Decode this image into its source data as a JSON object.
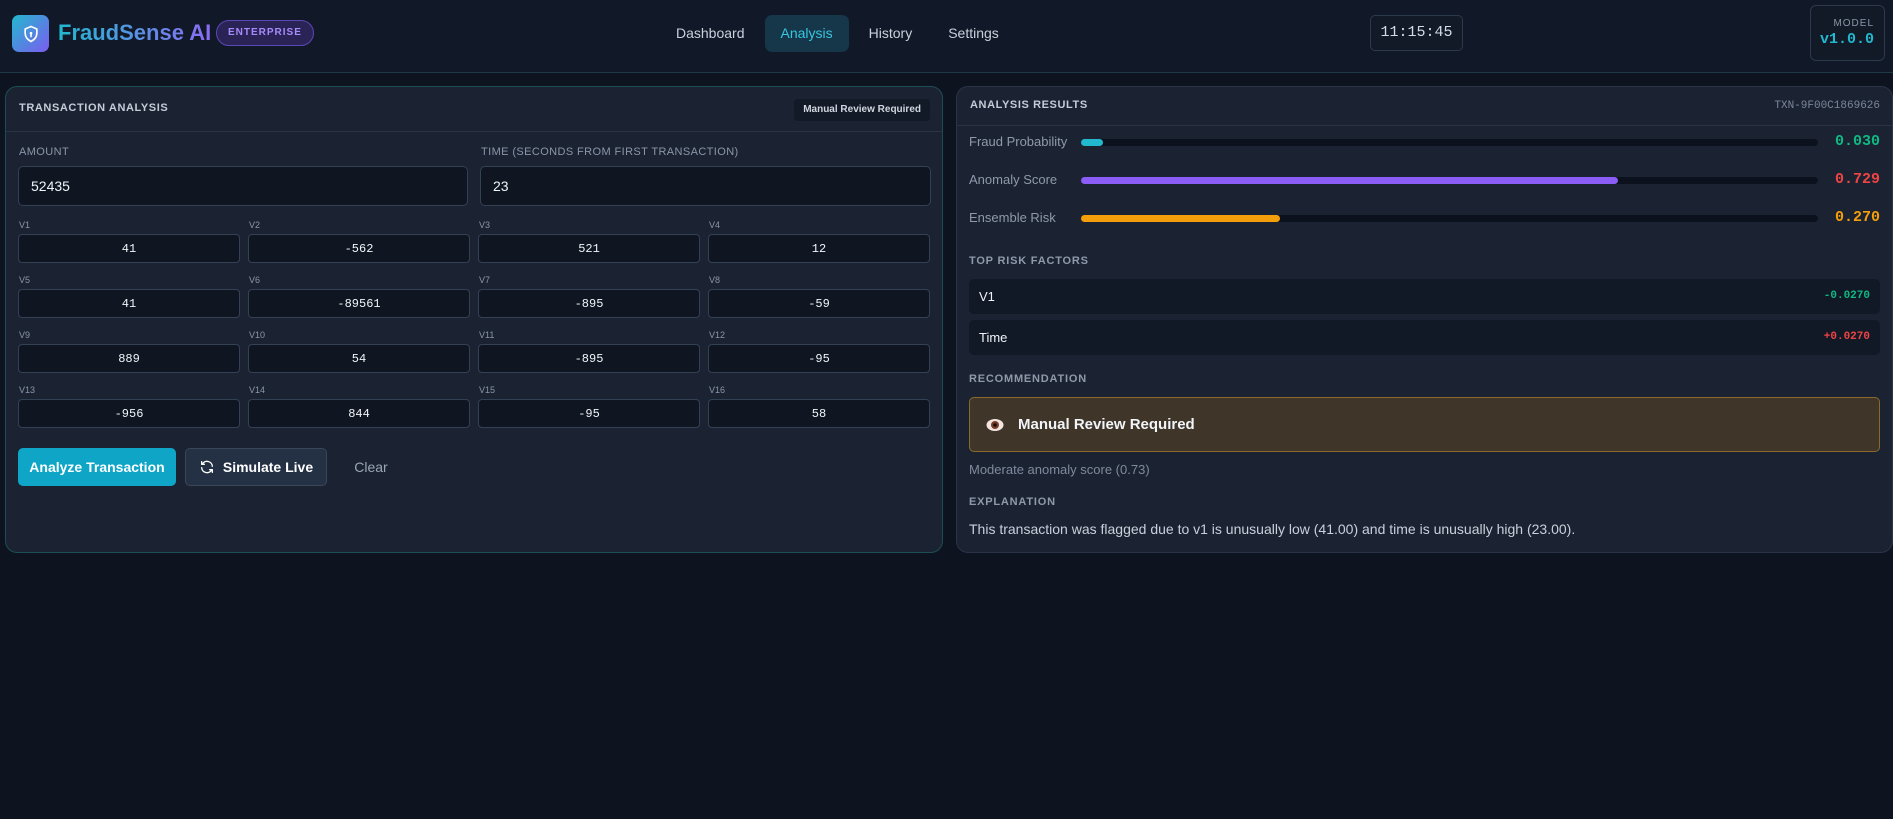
{
  "header": {
    "brand": "FraudSense AI",
    "badge": "ENTERPRISE",
    "nav": [
      "Dashboard",
      "Analysis",
      "History",
      "Settings"
    ],
    "active_nav": "Analysis",
    "clock": "11:15:45",
    "model_label": "MODEL",
    "model_version": "v1.0.0"
  },
  "transaction": {
    "title": "TRANSACTION ANALYSIS",
    "status_badge": "Manual Review Required",
    "amount_label": "AMOUNT",
    "amount_value": "52435",
    "time_label": "TIME (SECONDS FROM FIRST TRANSACTION)",
    "time_value": "23",
    "features": [
      {
        "label": "V1",
        "value": "41"
      },
      {
        "label": "V2",
        "value": "-562"
      },
      {
        "label": "V3",
        "value": "521"
      },
      {
        "label": "V4",
        "value": "12"
      },
      {
        "label": "V5",
        "value": "41"
      },
      {
        "label": "V6",
        "value": "-89561"
      },
      {
        "label": "V7",
        "value": "-895"
      },
      {
        "label": "V8",
        "value": "-59"
      },
      {
        "label": "V9",
        "value": "889"
      },
      {
        "label": "V10",
        "value": "54"
      },
      {
        "label": "V11",
        "value": "-895"
      },
      {
        "label": "V12",
        "value": "-95"
      },
      {
        "label": "V13",
        "value": "-956"
      },
      {
        "label": "V14",
        "value": "844"
      },
      {
        "label": "V15",
        "value": "-95"
      },
      {
        "label": "V16",
        "value": "58"
      }
    ],
    "analyze_label": "Analyze Transaction",
    "simulate_label": "Simulate Live",
    "clear_label": "Clear"
  },
  "results": {
    "title": "ANALYSIS RESULTS",
    "txn_id": "TXN-9F00C1869626",
    "metrics": [
      {
        "label": "Fraud Probability",
        "value": "0.030",
        "level": 0.03,
        "color": "#22b8cf",
        "value_color": "#10b981"
      },
      {
        "label": "Anomaly Score",
        "value": "0.729",
        "level": 0.729,
        "color": "#8b5cf6",
        "value_color": "#ef4444"
      },
      {
        "label": "Ensemble Risk",
        "value": "0.270",
        "level": 0.27,
        "color": "#f59e0b",
        "value_color": "#f59e0b"
      }
    ],
    "risk_title": "TOP RISK FACTORS",
    "risk_factors": [
      {
        "name": "V1",
        "value": "-0.0270",
        "color": "#10b981"
      },
      {
        "name": "Time",
        "value": "+0.0270",
        "color": "#ef4444"
      }
    ],
    "recommendation_title": "RECOMMENDATION",
    "recommendation": "Manual Review Required",
    "recommendation_icon": "eye-icon",
    "recommendation_detail": "Moderate anomaly score (0.73)",
    "explanation_title": "EXPLANATION",
    "explanation": "This transaction was flagged due to v1 is unusually low (41.00) and time is unusually high (23.00)."
  }
}
